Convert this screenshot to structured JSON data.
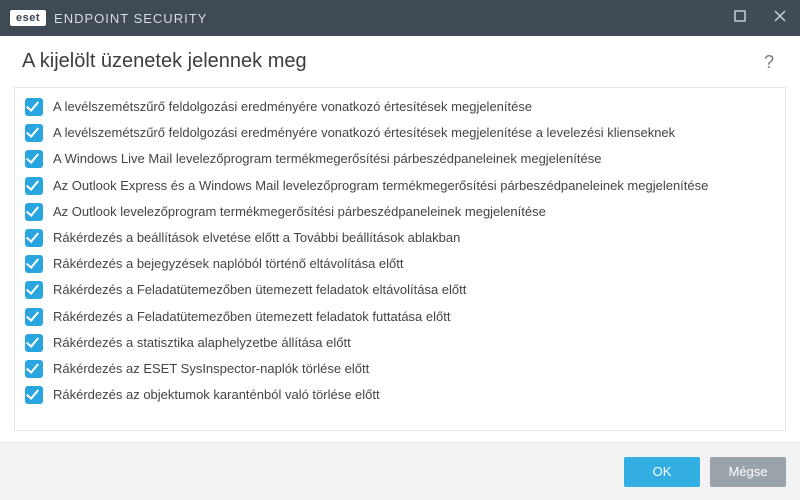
{
  "titlebar": {
    "brand": "eset",
    "product": "ENDPOINT SECURITY"
  },
  "header": {
    "title": "A kijelölt üzenetek jelennek meg",
    "help": "?"
  },
  "items": [
    {
      "checked": true,
      "label": "A levélszemétszűrő feldolgozási eredményére vonatkozó értesítések megjelenítése"
    },
    {
      "checked": true,
      "label": "A levélszemétszűrő feldolgozási eredményére vonatkozó értesítések megjelenítése a levelezési klienseknek"
    },
    {
      "checked": true,
      "label": "A Windows Live Mail levelezőprogram termékmegerősítési párbeszédpaneleinek megjelenítése"
    },
    {
      "checked": true,
      "label": "Az Outlook Express és a Windows Mail levelezőprogram termékmegerősítési párbeszédpaneleinek megjelenítése"
    },
    {
      "checked": true,
      "label": "Az Outlook levelezőprogram termékmegerősítési párbeszédpaneleinek megjelenítése"
    },
    {
      "checked": true,
      "label": "Rákérdezés a beállítások elvetése előtt a További beállítások ablakban"
    },
    {
      "checked": true,
      "label": "Rákérdezés a bejegyzések naplóból történő eltávolítása előtt"
    },
    {
      "checked": true,
      "label": "Rákérdezés a Feladatütemezőben ütemezett feladatok eltávolítása előtt"
    },
    {
      "checked": true,
      "label": "Rákérdezés a Feladatütemezőben ütemezett feladatok futtatása előtt"
    },
    {
      "checked": true,
      "label": "Rákérdezés a statisztika alaphelyzetbe állítása előtt"
    },
    {
      "checked": true,
      "label": "Rákérdezés az ESET SysInspector-naplók törlése előtt"
    },
    {
      "checked": true,
      "label": "Rákérdezés az objektumok karanténból való törlése előtt"
    }
  ],
  "footer": {
    "ok": "OK",
    "cancel": "Mégse"
  }
}
